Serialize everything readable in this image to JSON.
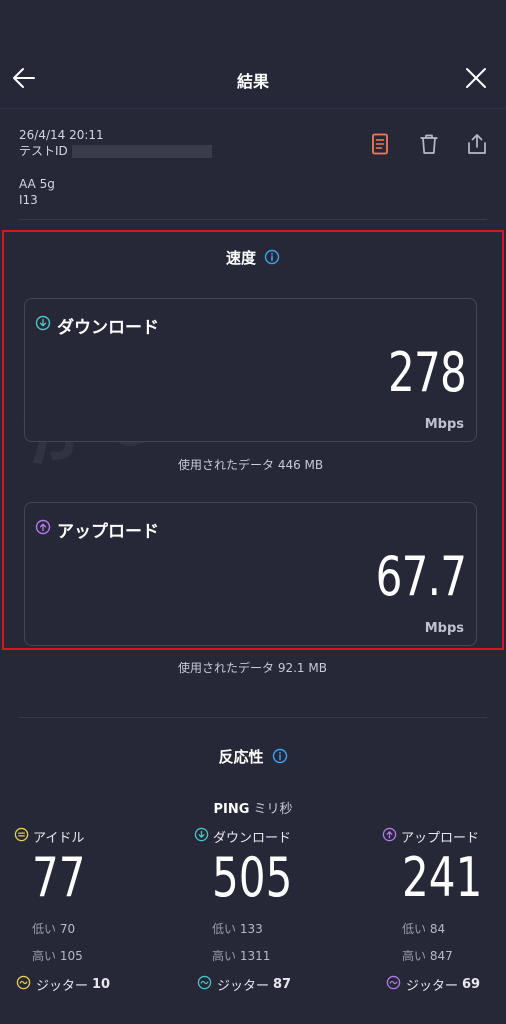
{
  "header": {
    "title": "結果"
  },
  "meta": {
    "datetime": "26/4/14 20:11",
    "test_id_label": "テストID",
    "network": "AA 5g",
    "device": "I13"
  },
  "speed": {
    "title": "速度",
    "download": {
      "label": "ダウンロード",
      "value": "278",
      "unit": "Mbps",
      "usage": "使用されたデータ 446 MB"
    },
    "upload": {
      "label": "アップロード",
      "value": "67.7",
      "unit": "Mbps",
      "usage": "使用されたデータ 92.1 MB"
    }
  },
  "watermark": "かしこ暮らし",
  "responsiveness": {
    "title": "反応性",
    "ping_label": "PING",
    "ping_unit": "ミリ秒",
    "columns": [
      {
        "label": "アイドル",
        "value": "77",
        "low_label": "低い",
        "low": "70",
        "high_label": "高い",
        "high": "105",
        "jitter_label": "ジッター",
        "jitter": "10"
      },
      {
        "label": "ダウンロード",
        "value": "505",
        "low_label": "低い",
        "low": "133",
        "high_label": "高い",
        "high": "1311",
        "jitter_label": "ジッター",
        "jitter": "87"
      },
      {
        "label": "アップロード",
        "value": "241",
        "low_label": "低い",
        "low": "84",
        "high_label": "高い",
        "high": "847",
        "jitter_label": "ジッター",
        "jitter": "69"
      }
    ]
  },
  "colors": {
    "background": "#262737",
    "download_accent": "#4ec4c4",
    "upload_accent": "#b07be8",
    "idle_accent": "#e7cf55",
    "info_accent": "#3ea3f0",
    "highlight_border": "#d7171a",
    "doc_icon": "#f07a5a"
  }
}
